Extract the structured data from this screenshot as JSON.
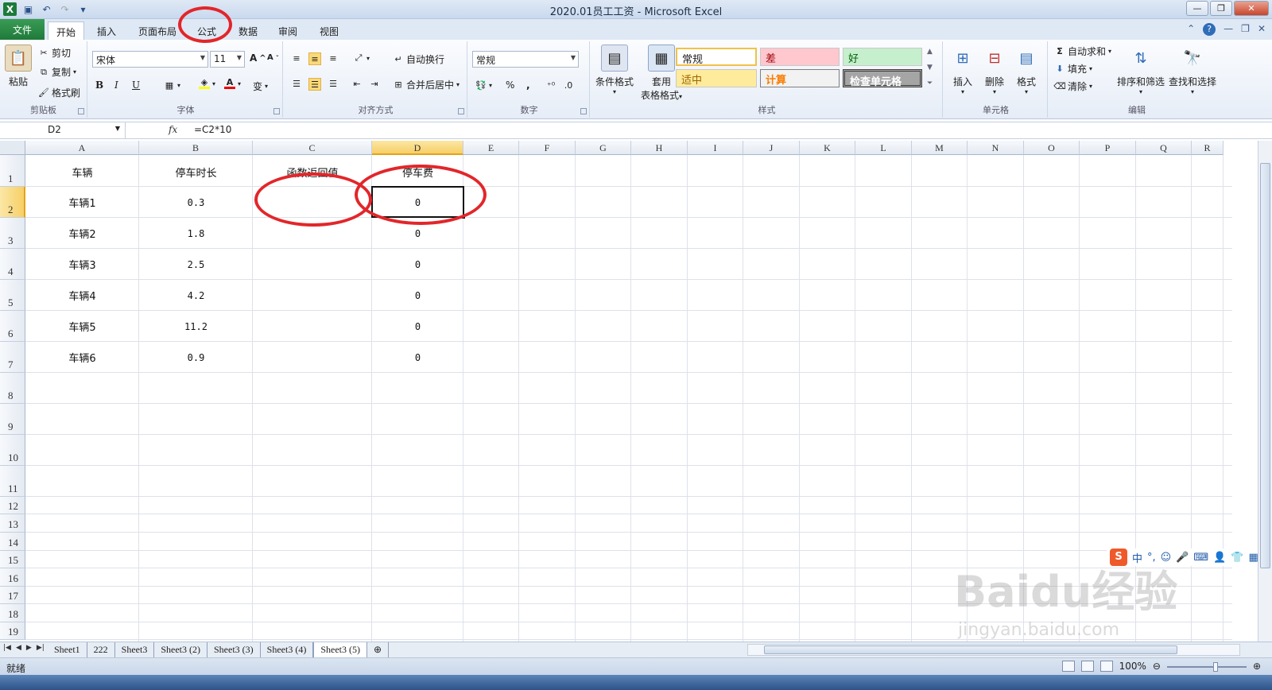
{
  "window": {
    "title": "2020.01员工工资 - Microsoft Excel",
    "app_icon": "excel-icon"
  },
  "ribbon_tabs": [
    "文件",
    "开始",
    "插入",
    "页面布局",
    "公式",
    "数据",
    "审阅",
    "视图"
  ],
  "active_tab": "开始",
  "clipboard": {
    "paste": "粘贴",
    "cut": "剪切",
    "copy": "复制",
    "format_painter": "格式刷",
    "label": "剪贴板"
  },
  "font": {
    "name": "宋体",
    "size": "11",
    "label": "字体",
    "grow": "A",
    "shrink": "A",
    "bold": "B",
    "italic": "I",
    "underline": "U",
    "wen": "变"
  },
  "alignment": {
    "wrap": "自动换行",
    "merge": "合并后居中",
    "label": "对齐方式"
  },
  "number": {
    "format": "常规",
    "percent": "%",
    "comma": ",",
    "label": "数字"
  },
  "styles": {
    "conditional": "条件格式",
    "table_1": "套用",
    "table_2": "表格格式",
    "normal": "常规",
    "bad": "差",
    "good": "好",
    "neutral": "适中",
    "calc": "计算",
    "check": "检查单元格",
    "label": "样式"
  },
  "cells_group": {
    "insert": "插入",
    "delete": "删除",
    "format": "格式",
    "label": "单元格"
  },
  "editing": {
    "autosum": "自动求和",
    "fill": "填充",
    "clear": "清除",
    "sort": "排序和筛选",
    "find": "查找和选择",
    "label": "编辑"
  },
  "formula_bar": {
    "name_box": "D2",
    "fx": "fx",
    "formula": "=C2*10"
  },
  "columns": [
    "A",
    "B",
    "C",
    "D",
    "E",
    "F",
    "G",
    "H",
    "I",
    "J",
    "K",
    "L",
    "M",
    "N",
    "O",
    "P",
    "Q",
    "R"
  ],
  "rows": [
    "1",
    "2",
    "3",
    "4",
    "5",
    "6",
    "7",
    "8",
    "9",
    "10",
    "11",
    "12",
    "13",
    "14",
    "15",
    "16",
    "17",
    "18",
    "19"
  ],
  "table": {
    "headers": [
      "车辆",
      "停车时长",
      "函数返回值",
      "停车费"
    ],
    "body": [
      [
        "车辆1",
        "0.3",
        "",
        "0"
      ],
      [
        "车辆2",
        "1.8",
        "",
        "0"
      ],
      [
        "车辆3",
        "2.5",
        "",
        "0"
      ],
      [
        "车辆4",
        "4.2",
        "",
        "0"
      ],
      [
        "车辆5",
        "11.2",
        "",
        "0"
      ],
      [
        "车辆6",
        "0.9",
        "",
        "0"
      ]
    ]
  },
  "selected_cell": "D2",
  "sheets": [
    "Sheet1",
    "222",
    "Sheet3",
    "Sheet3 (2)",
    "Sheet3 (3)",
    "Sheet3 (4)",
    "Sheet3 (5)"
  ],
  "active_sheet": "Sheet3 (5)",
  "status": {
    "ready": "就绪",
    "zoom": "100%"
  },
  "ime": {
    "logo": "S",
    "lang": "中"
  },
  "watermark": {
    "brand": "Baidu经验",
    "url": "jingyan.baidu.com"
  },
  "colors": {
    "annotation_red": "#e2262a",
    "selected_header": "#f7cf66",
    "file_tab": "#1f7a3a"
  }
}
